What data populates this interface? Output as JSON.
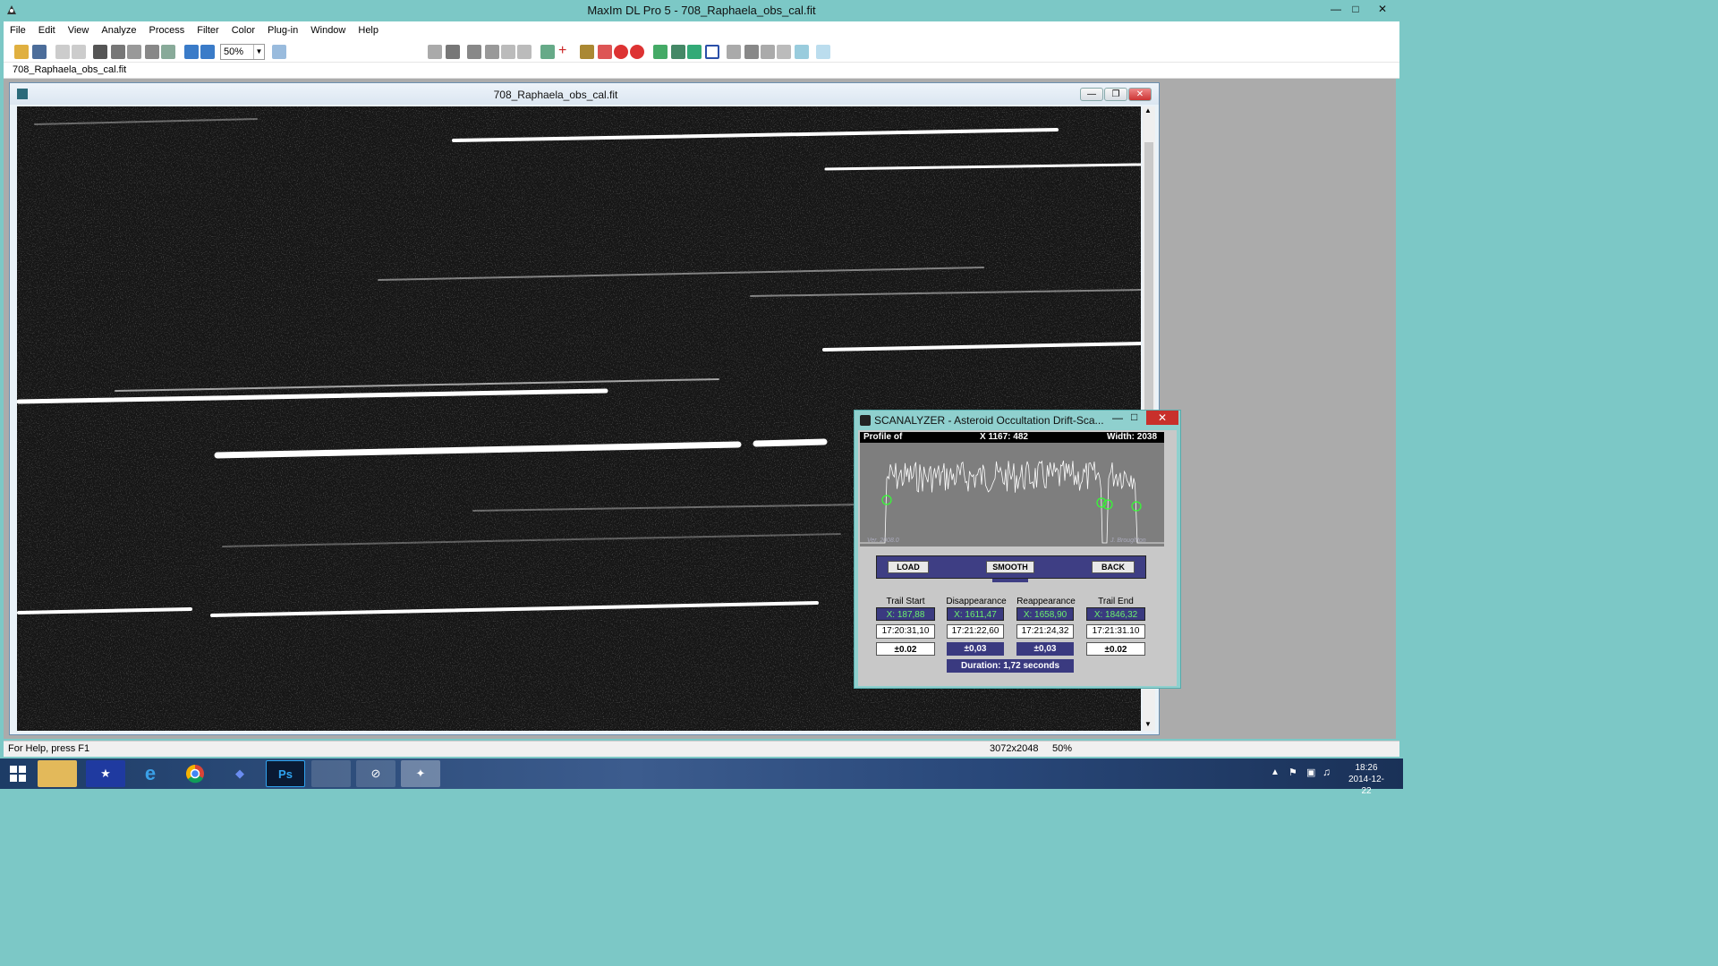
{
  "app": {
    "title": "MaxIm DL Pro 5 - 708_Raphaela_obs_cal.fit"
  },
  "menu": [
    "File",
    "Edit",
    "View",
    "Analyze",
    "Process",
    "Filter",
    "Color",
    "Plug-in",
    "Window",
    "Help"
  ],
  "toolbar": {
    "zoom": "50%"
  },
  "doc_tab": "708_Raphaela_obs_cal.fit",
  "image_window": {
    "title": "708_Raphaela_obs_cal.fit"
  },
  "scanalyzer": {
    "title": "SCANALYZER - Asteroid Occultation Drift-Sca...",
    "profile_label": "Profile of",
    "cursor": "X 1167: 482",
    "width": "Width: 2038",
    "credit_left": "Ver. 2008.0",
    "credit_right": "J. Broughton",
    "buttons": {
      "load": "LOAD",
      "smooth": "SMOOTH",
      "back": "BACK"
    },
    "columns": [
      {
        "header": "Trail Start",
        "x": "X:  187,88",
        "time": "17:20:31,10",
        "err": "±0.02"
      },
      {
        "header": "Disappearance",
        "x": "X:  1611,47",
        "time": "17:21:22,60",
        "err": "±0,03"
      },
      {
        "header": "Reappearance",
        "x": "X:  1658,90",
        "time": "17:21:24,32",
        "err": "±0,03"
      },
      {
        "header": "Trail End",
        "x": "X:  1846,32",
        "time": "17:21:31.10",
        "err": "±0.02"
      }
    ],
    "duration": "Duration:  1,72  seconds"
  },
  "status": {
    "help": "For Help, press F1",
    "dims": "3072x2048",
    "zoom": "50%"
  },
  "taskbar": {
    "time": "18:26",
    "date": "2014-12-22"
  }
}
